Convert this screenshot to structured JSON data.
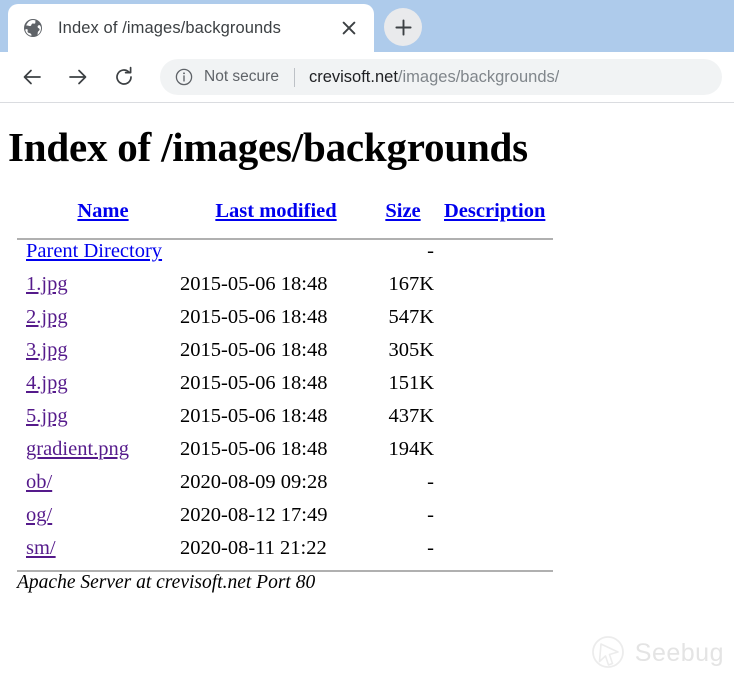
{
  "browser": {
    "tab": {
      "title": "Index of /images/backgrounds",
      "favicon": "globe-icon",
      "close_label": "✕"
    },
    "new_tab_label": "+",
    "nav": {
      "back_label": "←",
      "forward_label": "→",
      "reload_label": "↻"
    },
    "omnibox": {
      "security_icon": "info-circle-icon",
      "security_text": "Not secure",
      "url_host": "crevisoft.net",
      "url_path": "/images/backgrounds/"
    },
    "colors": {
      "tabstrip": "#aecbeb",
      "omnibox": "#f1f3f4",
      "toolbar_border": "#dadce0"
    }
  },
  "page": {
    "title": "Index of /images/backgrounds",
    "columns": {
      "name": "Name",
      "last_modified": "Last modified",
      "size": "Size",
      "description": "Description"
    },
    "parent": {
      "name": "Parent Directory",
      "last_modified": "",
      "size": "-",
      "description": ""
    },
    "entries": [
      {
        "name": "1.jpg",
        "last_modified": "2015-05-06 18:48",
        "size": "167K",
        "description": ""
      },
      {
        "name": "2.jpg",
        "last_modified": "2015-05-06 18:48",
        "size": "547K",
        "description": ""
      },
      {
        "name": "3.jpg",
        "last_modified": "2015-05-06 18:48",
        "size": "305K",
        "description": ""
      },
      {
        "name": "4.jpg",
        "last_modified": "2015-05-06 18:48",
        "size": "151K",
        "description": ""
      },
      {
        "name": "5.jpg",
        "last_modified": "2015-05-06 18:48",
        "size": "437K",
        "description": ""
      },
      {
        "name": "gradient.png",
        "last_modified": "2015-05-06 18:48",
        "size": "194K",
        "description": ""
      },
      {
        "name": "ob/",
        "last_modified": "2020-08-09 09:28",
        "size": "-",
        "description": ""
      },
      {
        "name": "og/",
        "last_modified": "2020-08-12 17:49",
        "size": "-",
        "description": ""
      },
      {
        "name": "sm/",
        "last_modified": "2020-08-11 21:22",
        "size": "-",
        "description": ""
      }
    ],
    "footer": "Apache Server at crevisoft.net Port 80",
    "link_colors": {
      "unvisited": "#0000ee",
      "visited": "#551a8b"
    }
  },
  "watermark": {
    "text": "Seebug",
    "icon": "seebug-logo-icon",
    "color": "#e3e3e3"
  }
}
